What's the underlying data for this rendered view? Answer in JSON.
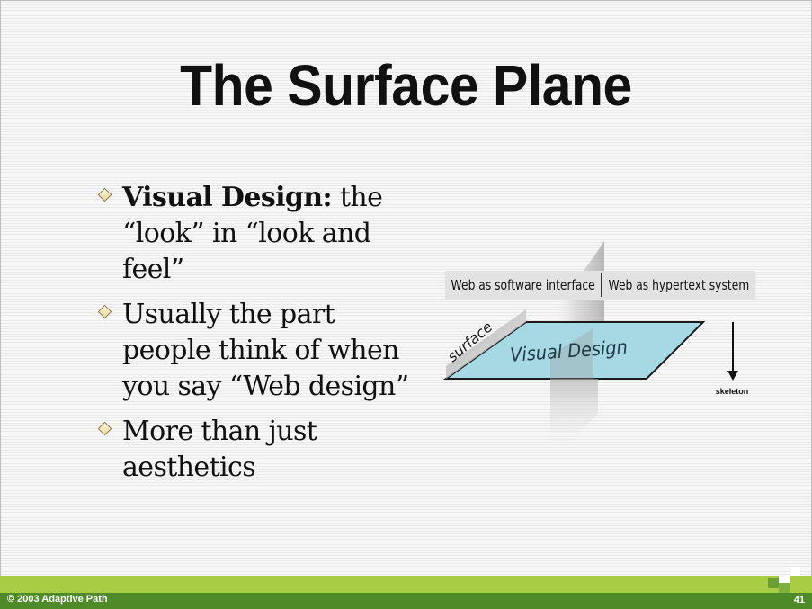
{
  "slide": {
    "title": "The Surface Plane",
    "bullets": [
      {
        "bold": "Visual Design:",
        "text": " the “look” in “look and feel”"
      },
      {
        "bold": "",
        "text": "Usually the part people think of when you say “Web design”"
      },
      {
        "bold": "",
        "text": "More than just aesthetics"
      }
    ]
  },
  "diagram": {
    "left_label": "Web as software interface",
    "right_label": "Web as hypertext system",
    "plane_side_label": "surface",
    "plane_label": "Visual Design",
    "arrow_label": "skeleton",
    "colors": {
      "plane_fill": "#a6d9e3",
      "plane_edge": "#1a1a1a",
      "label_bar": "#e2e2e2"
    }
  },
  "footer": {
    "copyright": "© 2003 Adaptive Path",
    "page_number": "41",
    "colors": {
      "light_band": "#a8cc44",
      "dark_band": "#4f8a28"
    }
  }
}
